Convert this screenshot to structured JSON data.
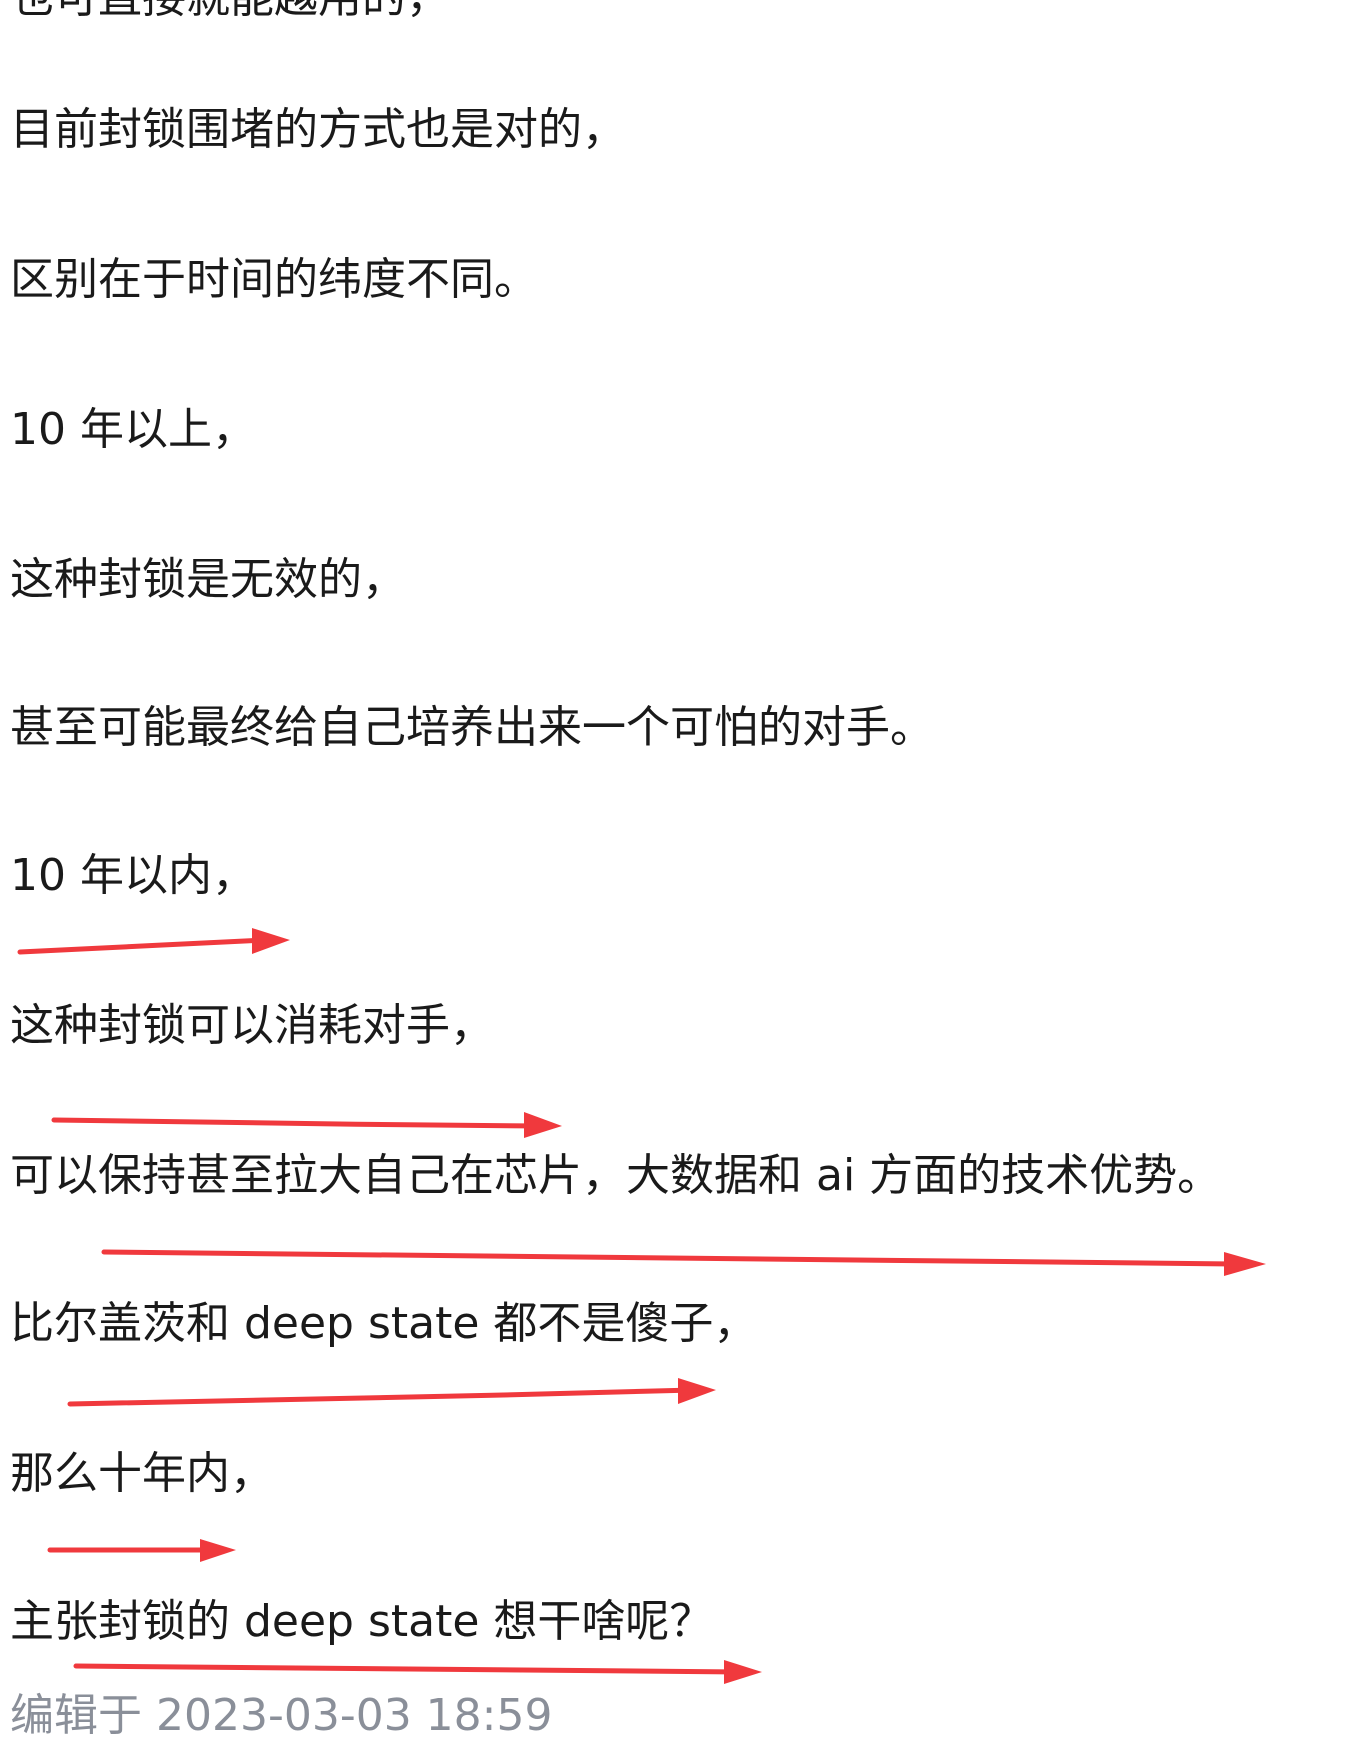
{
  "post": {
    "partial_first_line": "也可直接就能越用的，",
    "lines": [
      "目前封锁围堵的方式也是对的，",
      "区别在于时间的纬度不同。",
      "10 年以上，",
      "这种封锁是无效的，",
      "甚至可能最终给自己培养出来一个可怕的对手。",
      "10 年以内，",
      "这种封锁可以消耗对手，",
      "可以保持甚至拉大自己在芯片，大数据和 ai 方面的技术优势。",
      "比尔盖茨和 deep state 都不是傻子，",
      "那么十年内，",
      "主张封锁的 deep state 想干啥呢？"
    ],
    "edited_label": "编辑于 2023-03-03 18:59"
  },
  "annotations": {
    "arrow_color": "#f0393d",
    "arrow_icon": "red-arrow-right-icon"
  }
}
